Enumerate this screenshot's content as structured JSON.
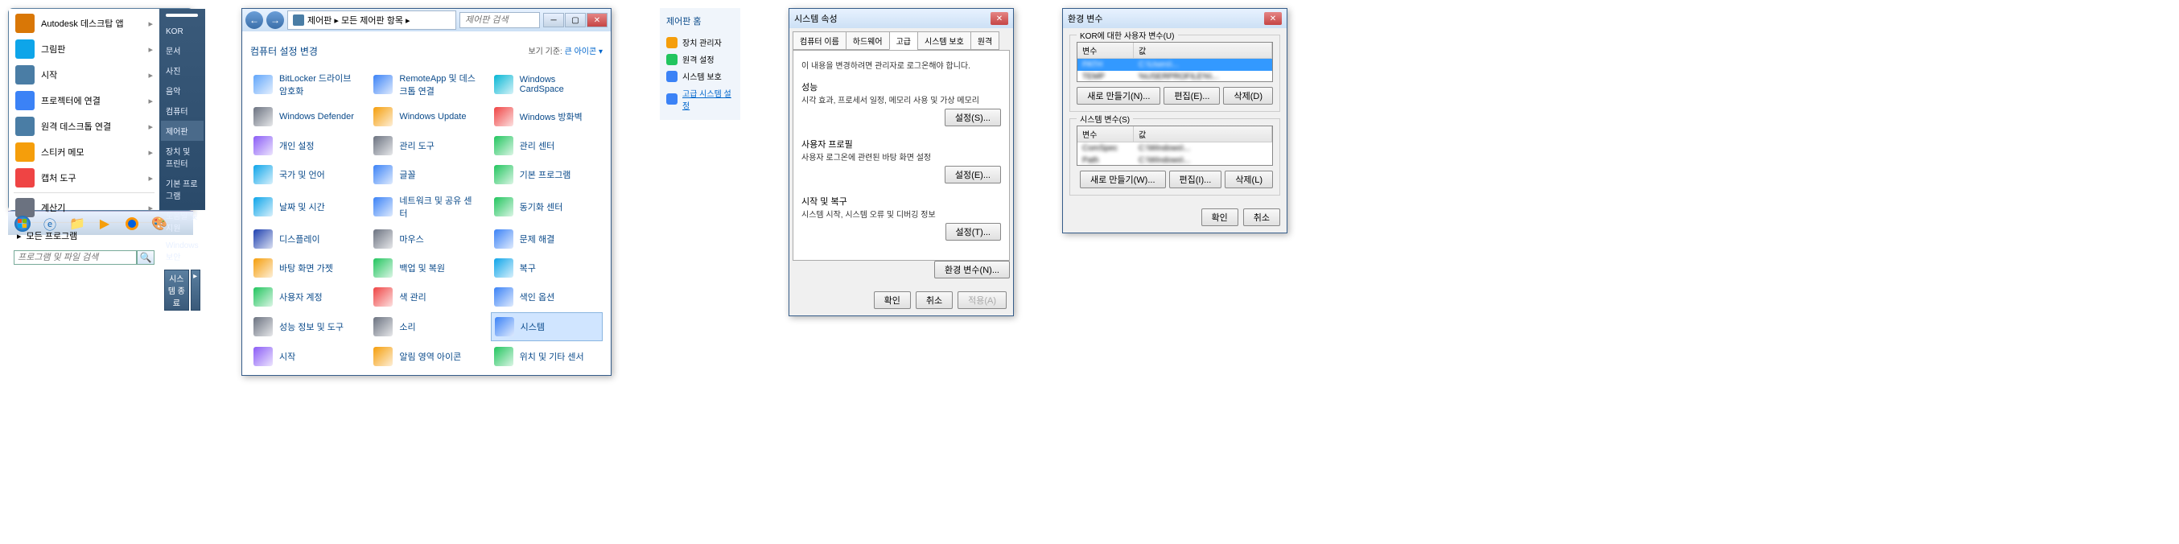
{
  "start_menu": {
    "left_items": [
      {
        "label": "Autodesk 데스크탑 앱",
        "icon": "#d97706"
      },
      {
        "label": "그림판",
        "icon": "#0ea5e9"
      },
      {
        "label": "시작",
        "icon": "#4a7da5"
      },
      {
        "label": "프로젝터에 연결",
        "icon": "#3b82f6"
      },
      {
        "label": "원격 데스크톱 연결",
        "icon": "#4a7da5"
      },
      {
        "label": "스티커 메모",
        "icon": "#f59e0b"
      },
      {
        "label": "캡처 도구",
        "icon": "#ef4444"
      },
      {
        "label": "계산기",
        "icon": "#6b7280"
      }
    ],
    "all_programs": "모든 프로그램",
    "search_placeholder": "프로그램 및 파일 검색",
    "right_items": [
      "KOR",
      "문서",
      "사진",
      "음악",
      "컴퓨터",
      "제어판",
      "장치 및 프린터",
      "기본 프로그램",
      "도움말 및 지원",
      "Windows 보안"
    ],
    "right_selected_index": 5,
    "shutdown": "시스템 종료"
  },
  "control_panel": {
    "breadcrumb": "제어판 ▸ 모든 제어판 항목 ▸",
    "search_placeholder": "제어판 검색",
    "heading": "컴퓨터 설정 변경",
    "view_label": "보기 기준:",
    "view_value": "큰 아이콘 ▾",
    "items": [
      {
        "label": "BitLocker 드라이브 암호화",
        "c": "#60a5fa"
      },
      {
        "label": "RemoteApp 및 데스크톱 연결",
        "c": "#3b82f6"
      },
      {
        "label": "Windows CardSpace",
        "c": "#06b6d4"
      },
      {
        "label": "Windows Defender",
        "c": "#6b7280"
      },
      {
        "label": "Windows Update",
        "c": "#f59e0b"
      },
      {
        "label": "Windows 방화벽",
        "c": "#ef4444"
      },
      {
        "label": "개인 설정",
        "c": "#8b5cf6"
      },
      {
        "label": "관리 도구",
        "c": "#6b7280"
      },
      {
        "label": "관리 센터",
        "c": "#22c55e"
      },
      {
        "label": "국가 및 언어",
        "c": "#0ea5e9"
      },
      {
        "label": "글꼴",
        "c": "#3b82f6"
      },
      {
        "label": "기본 프로그램",
        "c": "#22c55e"
      },
      {
        "label": "날짜 및 시간",
        "c": "#0ea5e9"
      },
      {
        "label": "네트워크 및 공유 센터",
        "c": "#3b82f6"
      },
      {
        "label": "동기화 센터",
        "c": "#22c55e"
      },
      {
        "label": "디스플레이",
        "c": "#1e40af"
      },
      {
        "label": "마우스",
        "c": "#6b7280"
      },
      {
        "label": "문제 해결",
        "c": "#3b82f6"
      },
      {
        "label": "바탕 화면 가젯",
        "c": "#f59e0b"
      },
      {
        "label": "백업 및 복원",
        "c": "#22c55e"
      },
      {
        "label": "복구",
        "c": "#0ea5e9"
      },
      {
        "label": "사용자 계정",
        "c": "#22c55e"
      },
      {
        "label": "색 관리",
        "c": "#ef4444"
      },
      {
        "label": "색인 옵션",
        "c": "#3b82f6"
      },
      {
        "label": "성능 정보 및 도구",
        "c": "#6b7280"
      },
      {
        "label": "소리",
        "c": "#6b7280"
      },
      {
        "label": "시스템",
        "c": "#3b82f6",
        "selected": true
      },
      {
        "label": "시작",
        "c": "#8b5cf6"
      },
      {
        "label": "알림 영역 아이콘",
        "c": "#f59e0b"
      },
      {
        "label": "위치 및 기타 센서",
        "c": "#22c55e"
      }
    ]
  },
  "cp_home": {
    "title": "제어판 홈",
    "items": [
      {
        "label": "장치 관리자",
        "c": "#f59e0b"
      },
      {
        "label": "원격 설정",
        "c": "#22c55e"
      },
      {
        "label": "시스템 보호",
        "c": "#3b82f6"
      },
      {
        "label": "고급 시스템 설정",
        "c": "#3b82f6",
        "link": true
      }
    ]
  },
  "sysprops": {
    "title": "시스템 속성",
    "tabs": [
      "컴퓨터 이름",
      "하드웨어",
      "고급",
      "시스템 보호",
      "원격"
    ],
    "active_tab": 2,
    "notice": "이 내용을 변경하려면 관리자로 로그온해야 합니다.",
    "groups": [
      {
        "title": "성능",
        "desc": "시각 효과, 프로세서 일정, 메모리 사용 및 가상 메모리",
        "btn": "설정(S)..."
      },
      {
        "title": "사용자 프로필",
        "desc": "사용자 로그온에 관련된 바탕 화면 설정",
        "btn": "설정(E)..."
      },
      {
        "title": "시작 및 복구",
        "desc": "시스템 시작, 시스템 오류 및 디버깅 정보",
        "btn": "설정(T)..."
      }
    ],
    "env_btn": "환경 변수(N)...",
    "ok": "확인",
    "cancel": "취소",
    "apply": "적용(A)"
  },
  "envvars": {
    "title": "환경 변수",
    "user_group": "KOR에 대한 사용자 변수(U)",
    "sys_group": "시스템 변수(S)",
    "col_var": "변수",
    "col_val": "값",
    "new_btn": "새로 만들기(N)...",
    "new_btn2": "새로 만들기(W)...",
    "edit_btn": "편집(E)...",
    "edit_btn2": "편집(I)...",
    "del_btn": "삭제(D)",
    "del_btn2": "삭제(L)",
    "ok": "확인",
    "cancel": "취소"
  }
}
